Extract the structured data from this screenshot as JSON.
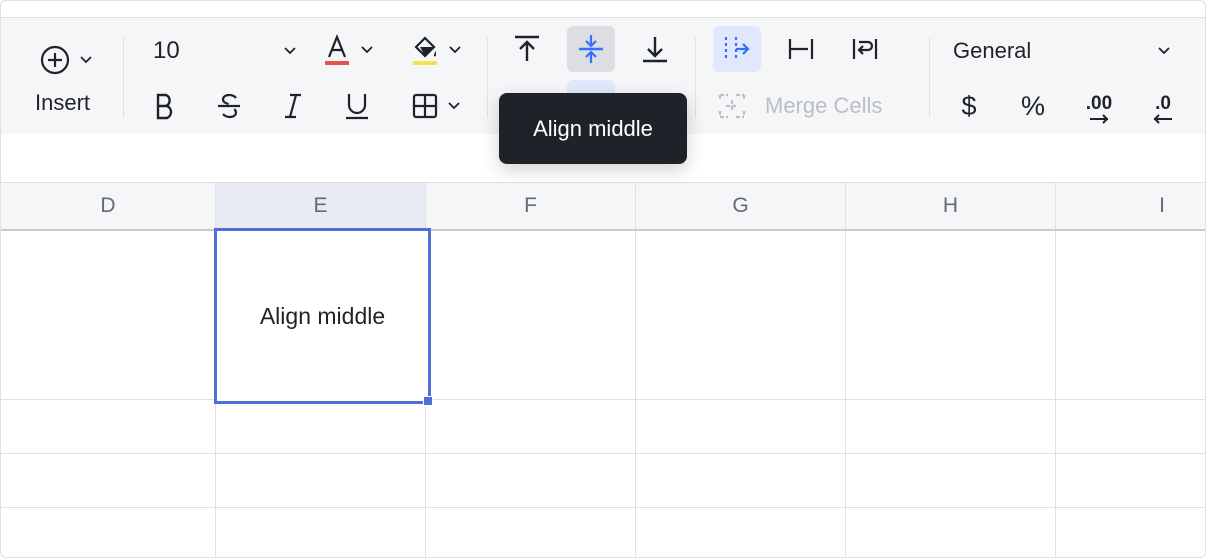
{
  "toolbar": {
    "insert_label": "Insert",
    "font_size": "10",
    "number_format": "General",
    "merge_cells_label": "Merge Cells",
    "currency_symbol": "$",
    "percent_symbol": "%",
    "decrease_decimal_text": ".00",
    "increase_decimal_text": ".0",
    "font_color_swatch": "#e5534b",
    "fill_color_swatch": "#f5e050",
    "accent_color": "#3370ff"
  },
  "tooltip": {
    "text": "Align middle"
  },
  "sheet": {
    "columns": [
      "D",
      "E",
      "F",
      "G",
      "H",
      "I"
    ],
    "selected_column": "E",
    "selected_cell_text": "Align middle"
  }
}
